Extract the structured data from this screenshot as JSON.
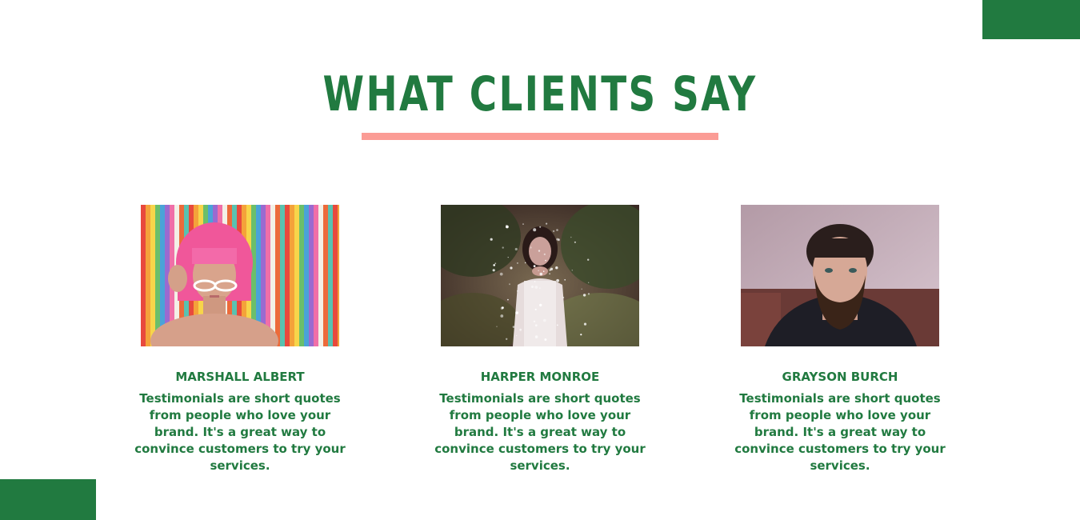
{
  "heading": "WHAT CLIENTS SAY",
  "colors": {
    "brand_green": "#217a40",
    "accent_pink": "#fb9c95"
  },
  "testimonials": [
    {
      "name": "MARSHALL ALBERT",
      "quote": "Testimonials are short quotes from people who love your brand. It's a great way to convince customers to try your services."
    },
    {
      "name": "HARPER MONROE",
      "quote": "Testimonials are short quotes from people who love your brand. It's a great way to convince customers to try your services."
    },
    {
      "name": "GRAYSON BURCH",
      "quote": "Testimonials are short quotes from people who love your brand. It's a great way to convince customers to try your services."
    }
  ]
}
